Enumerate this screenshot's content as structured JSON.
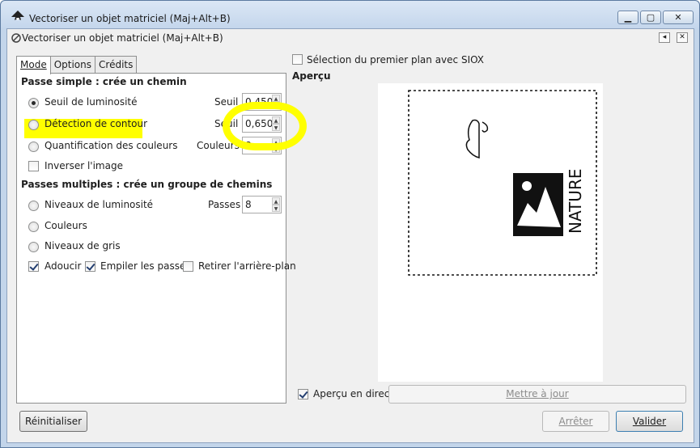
{
  "window": {
    "title": "Vectoriser un objet matriciel (Maj+Alt+B)",
    "controls": [
      "minimize",
      "maximize",
      "close"
    ]
  },
  "dock": {
    "title": "Vectoriser un objet matriciel (Maj+Alt+B)"
  },
  "tabs": [
    "Mode",
    "Options",
    "Crédits"
  ],
  "mode": {
    "single_pass": {
      "heading": "Passe simple : crée un chemin",
      "brightness": {
        "label": "Seuil de luminosité",
        "param_label": "Seuil :",
        "value": "0,450",
        "selected": true
      },
      "edge": {
        "label": "Détection de contour",
        "param_label": "Seuil :",
        "value": "0,650",
        "selected": false
      },
      "color_quant": {
        "label": "Quantification des couleurs",
        "param_label": "Couleurs :",
        "value": "8",
        "selected": false
      },
      "invert": {
        "label": "Inverser l'image",
        "checked": false
      }
    },
    "multi_pass": {
      "heading": "Passes multiples : crée un groupe de chemins",
      "brightness_levels": {
        "label": "Niveaux de luminosité",
        "param_label": "Passes :",
        "value": "8",
        "selected": false
      },
      "colors": {
        "label": "Couleurs",
        "selected": false
      },
      "grays": {
        "label": "Niveaux de gris",
        "selected": false
      },
      "smooth": {
        "label": "Adoucir",
        "checked": true
      },
      "stack": {
        "label": "Empiler les passes",
        "checked": true
      },
      "remove_bg": {
        "label": "Retirer l'arrière-plan",
        "checked": false
      }
    }
  },
  "siox": {
    "label": "Sélection du premier plan avec SIOX",
    "checked": false
  },
  "preview": {
    "heading": "Aperçu",
    "image_text": "NATURE",
    "live_label": "Aperçu en direct",
    "live_checked": true,
    "update_button": "Mettre à jour"
  },
  "buttons": {
    "reset": "Réinitialiser",
    "stop": "Arrêter",
    "ok": "Valider"
  },
  "colors": {
    "highlight": "#ffff00",
    "window_frame": "#c3d5ea"
  }
}
